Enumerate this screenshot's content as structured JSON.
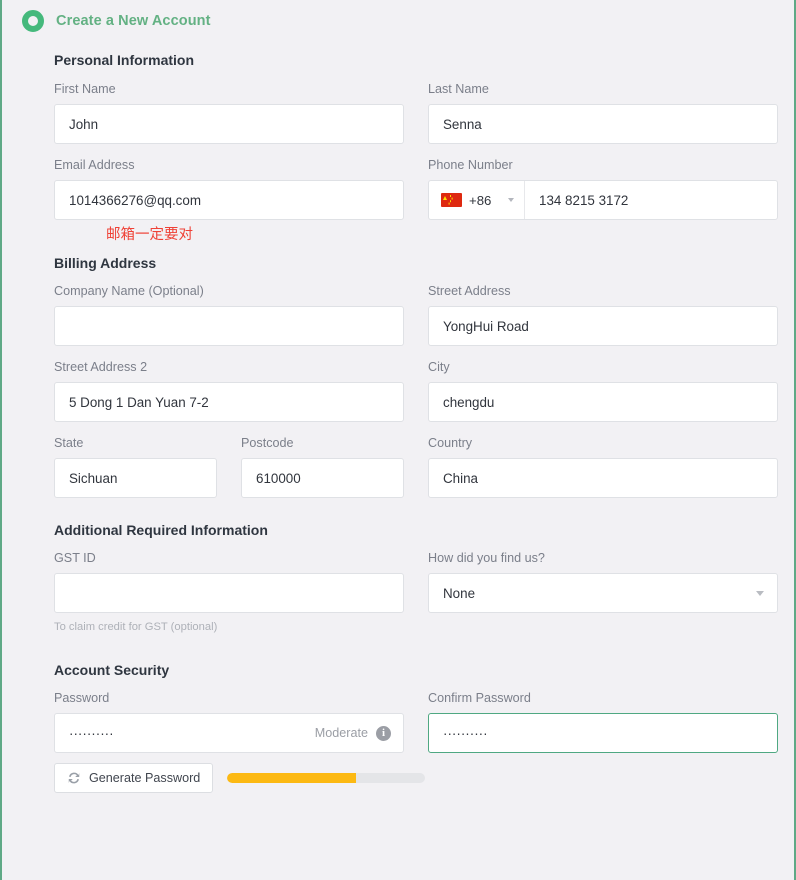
{
  "header": {
    "icon": "ring-icon",
    "title": "Create a New Account",
    "accent_color": "#63b183"
  },
  "theme": {
    "page_background": "#f2f1f4",
    "frame_border": "#5fa986",
    "input_background": "#ffffff",
    "input_border": "#dfe1e5",
    "focus_border": "#4fa882",
    "label_color": "#7b7f8a",
    "heading_color": "#2f3640",
    "annotation_color": "#ef4136",
    "strength_bar_color": "#fcb913",
    "strength_bar_track": "#e4e5e8"
  },
  "sections": {
    "personal": {
      "title": "Personal Information",
      "first_name": {
        "label": "First Name",
        "value": "John",
        "placeholder": ""
      },
      "last_name": {
        "label": "Last Name",
        "value": "Senna",
        "placeholder": ""
      },
      "email": {
        "label": "Email Address",
        "value": "1014366276@qq.com",
        "placeholder": ""
      },
      "email_annotation": "邮箱一定要对",
      "phone": {
        "label": "Phone Number",
        "dial_code": "+86",
        "flag": "flag-cn-icon",
        "value": "134 8215 3172",
        "placeholder": ""
      }
    },
    "billing": {
      "title": "Billing Address",
      "company": {
        "label": "Company Name (Optional)",
        "value": "",
        "placeholder": ""
      },
      "street1": {
        "label": "Street Address",
        "value": "YongHui Road",
        "placeholder": ""
      },
      "street2": {
        "label": "Street Address 2",
        "value": "5 Dong 1 Dan Yuan 7-2",
        "placeholder": ""
      },
      "city": {
        "label": "City",
        "value": "chengdu",
        "placeholder": ""
      },
      "state": {
        "label": "State",
        "value": "Sichuan",
        "placeholder": ""
      },
      "postcode": {
        "label": "Postcode",
        "value": "610000",
        "placeholder": ""
      },
      "country": {
        "label": "Country",
        "value": "China",
        "placeholder": ""
      }
    },
    "additional": {
      "title": "Additional Required Information",
      "gst_id": {
        "label": "GST ID",
        "value": "",
        "placeholder": "",
        "helper": "To claim credit for GST (optional)"
      },
      "find_us": {
        "label": "How did you find us?",
        "selected": "None",
        "options": [
          "None"
        ]
      }
    },
    "security": {
      "title": "Account Security",
      "password": {
        "label": "Password",
        "value": "··········",
        "strength_label": "Moderate",
        "info_icon": "info-icon",
        "strength_percent": 65
      },
      "confirm_password": {
        "label": "Confirm Password",
        "value": "··········",
        "focused": true
      },
      "generate_button": {
        "label": "Generate Password",
        "icon": "refresh-icon"
      }
    }
  }
}
